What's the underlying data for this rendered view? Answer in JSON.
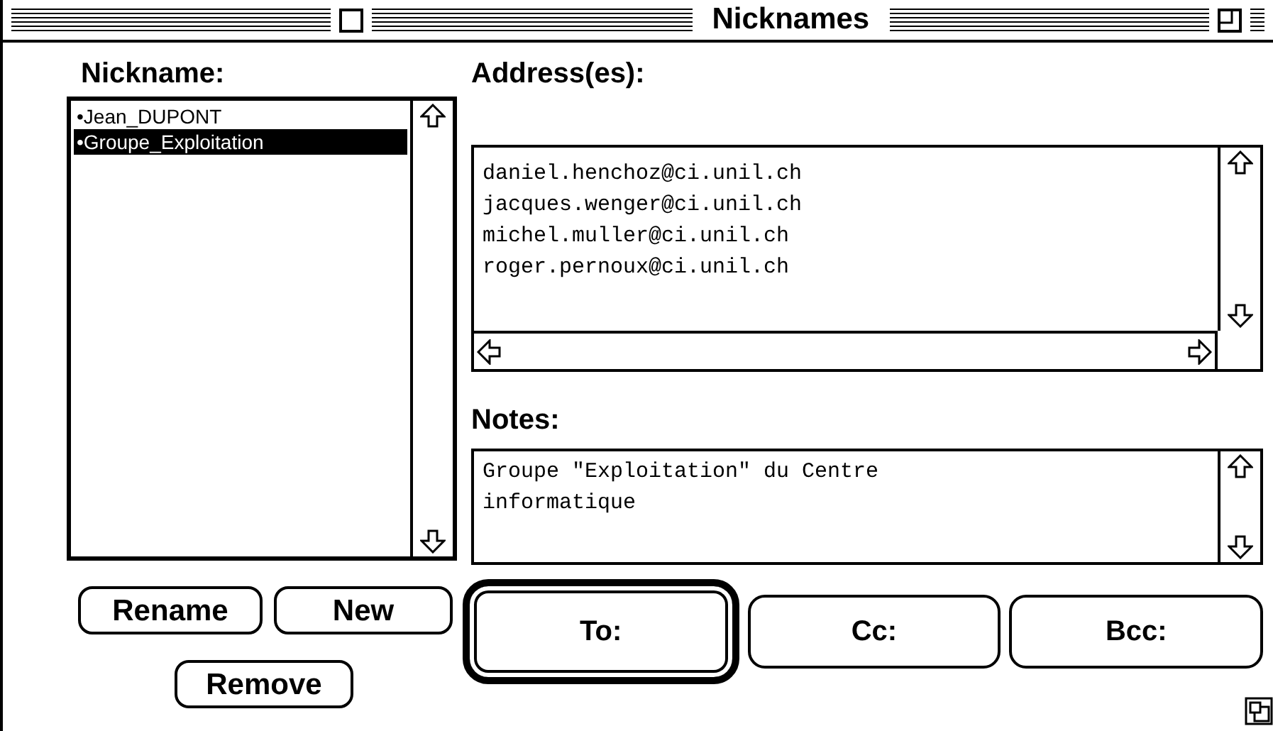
{
  "window": {
    "title": "Nicknames"
  },
  "nickname": {
    "label": "Nickname:",
    "items": [
      {
        "label": "•Jean_DUPONT",
        "selected": false
      },
      {
        "label": "•Groupe_Exploitation",
        "selected": true
      }
    ]
  },
  "nickname_buttons": [
    "Rename",
    "New",
    "Remove"
  ],
  "addresses": {
    "label": "Address(es):",
    "lines": [
      "daniel.henchoz@ci.unil.ch",
      "jacques.wenger@ci.unil.ch",
      "michel.muller@ci.unil.ch",
      "roger.pernoux@ci.unil.ch"
    ]
  },
  "notes": {
    "label": "Notes:",
    "lines": [
      "Groupe \"Exploitation\" du Centre",
      "informatique"
    ]
  },
  "send_buttons": [
    {
      "label": "To:",
      "default": true
    },
    {
      "label": "Cc:",
      "default": false
    },
    {
      "label": "Bcc:",
      "default": false
    }
  ]
}
